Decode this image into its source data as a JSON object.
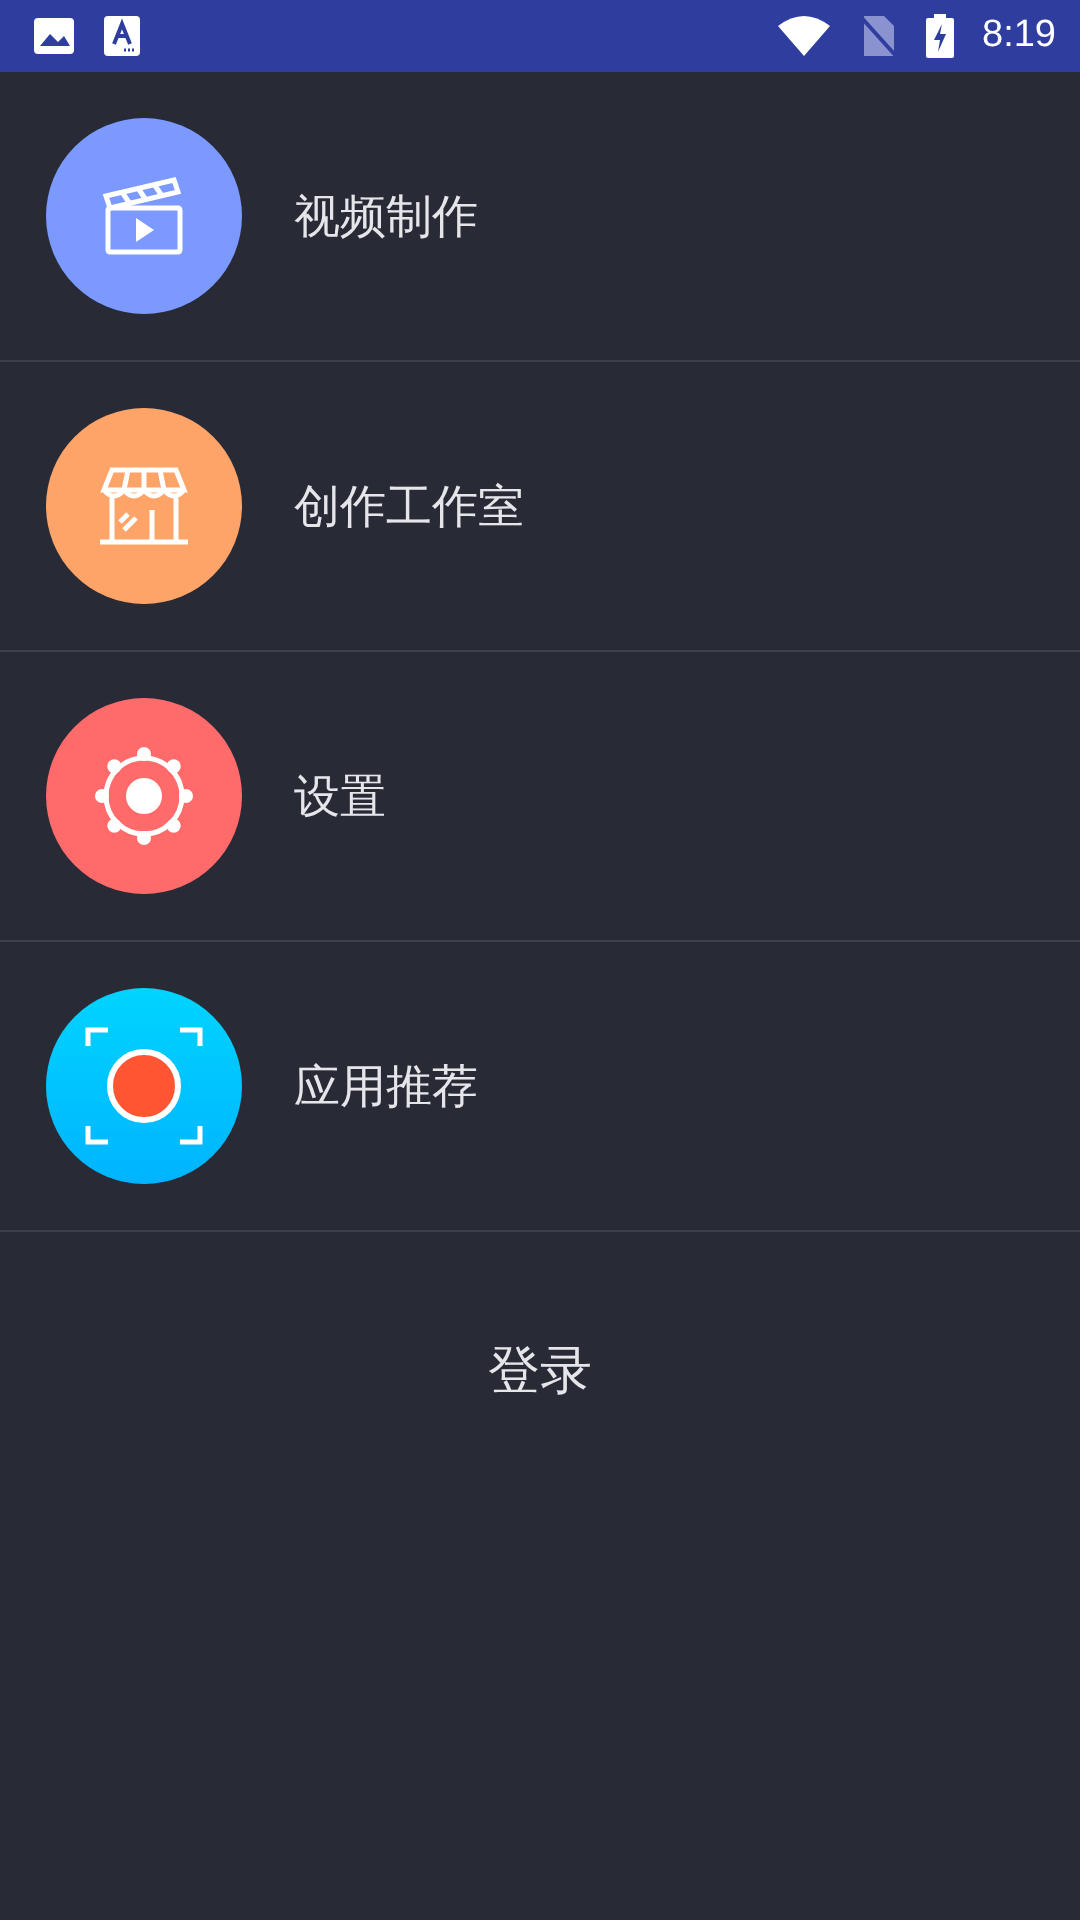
{
  "status_bar": {
    "time": "8:19"
  },
  "menu": [
    {
      "label": "视频制作",
      "kind": "video",
      "color": "#7b99ff"
    },
    {
      "label": "创作工作室",
      "kind": "store",
      "color": "#ffa468"
    },
    {
      "label": "设置",
      "kind": "settings",
      "color": "#ff6b6b"
    },
    {
      "label": "应用推荐",
      "kind": "record",
      "color": "#00b4ff"
    }
  ],
  "login": "登录"
}
